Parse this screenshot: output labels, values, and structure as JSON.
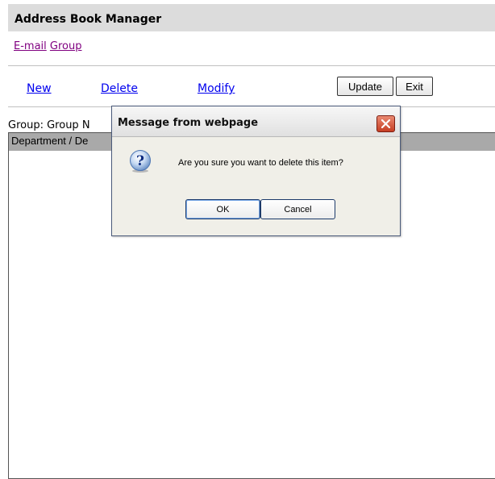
{
  "app": {
    "title": "Address Book Manager"
  },
  "nav": {
    "email_link": "E-mail",
    "group_link": "Group"
  },
  "toolbar": {
    "new_label": "New",
    "delete_label": "Delete",
    "modify_label": "Modify",
    "update_label": "Update",
    "exit_label": "Exit"
  },
  "group": {
    "label": "Group:",
    "value": "Group N"
  },
  "list": {
    "header": "Department / De"
  },
  "dialog": {
    "title": "Message from webpage",
    "message": "Are you sure you want to delete this item?",
    "ok_label": "OK",
    "cancel_label": "Cancel",
    "icon": "question-icon"
  },
  "colors": {
    "title_bar_bg": "#dcdcdc",
    "visited_link": "#800080",
    "link": "#0000ee",
    "list_header_bg": "#a9a9a9",
    "close_button": "#c63e23"
  }
}
